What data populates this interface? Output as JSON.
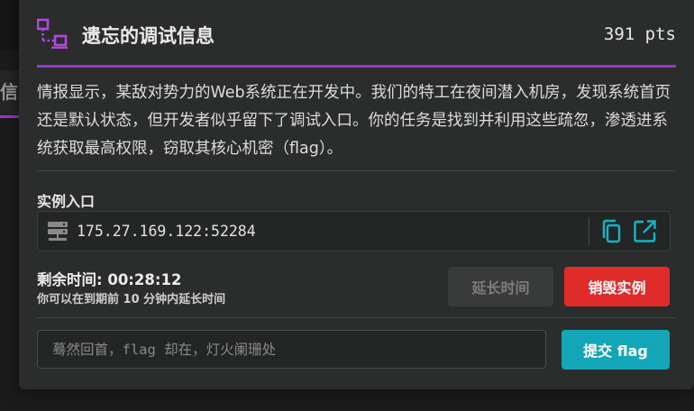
{
  "background": {
    "tab_text": "信息"
  },
  "challenge": {
    "title": "遗忘的调试信息",
    "points": "391 pts",
    "description": "情报显示，某敌对势力的Web系统正在开发中。我们的特工在夜间潜入机房，发现系统首页还是默认状态，但开发者似乎留下了调试入口。你的任务是找到并利用这些疏忽，渗透进系统获取最高权限，窃取其核心机密（flag）。"
  },
  "instance": {
    "label": "实例入口",
    "address": "175.27.169.122:52284"
  },
  "timer": {
    "label": "剩余时间: 00:28:12",
    "hint": "你可以在到期前 10 分钟内延长时间"
  },
  "actions": {
    "extend_label": "延长时间",
    "destroy_label": "销毁实例"
  },
  "flag": {
    "placeholder": "蓦然回首，flag 却在，灯火阑珊处",
    "value": "",
    "submit_label": "提交 flag"
  },
  "colors": {
    "accent_purple": "#9b37c9",
    "danger_red": "#e02b2b",
    "submit_teal": "#12a6b8",
    "icon_teal": "#12b6c8"
  },
  "icons": {
    "title_icon": "network-nodes-icon",
    "server_icon": "server-icon",
    "copy_icon": "copy-icon",
    "open_icon": "external-link-icon"
  }
}
